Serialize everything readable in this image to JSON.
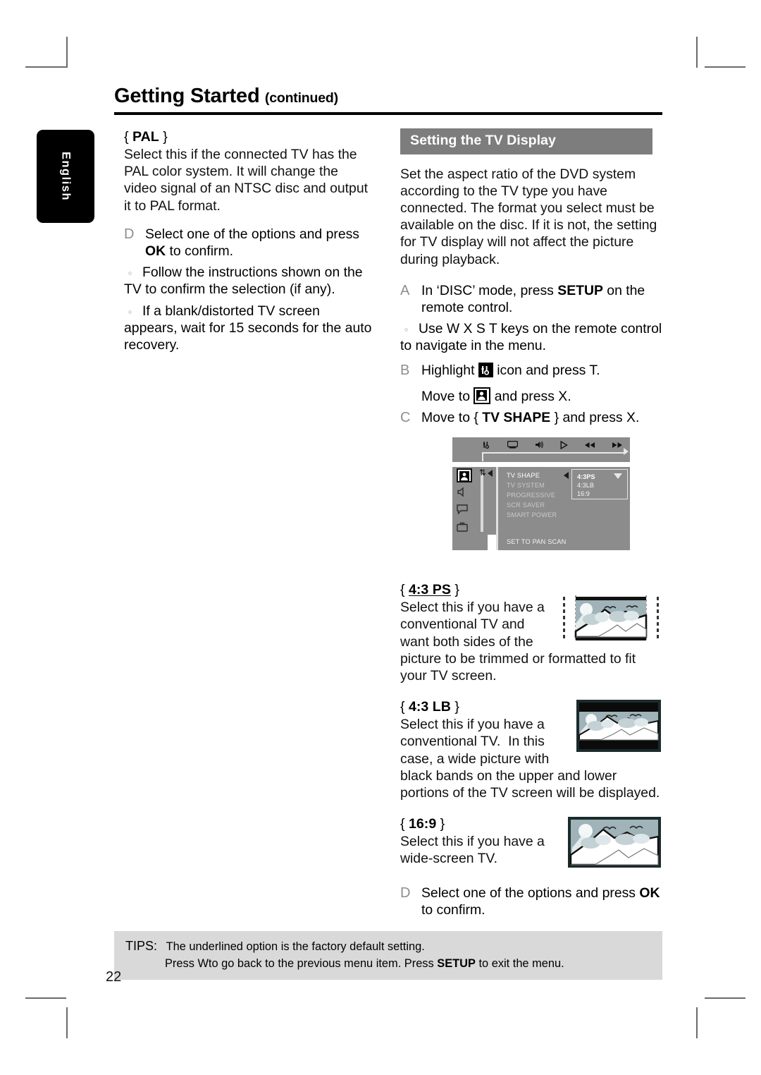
{
  "page": {
    "number": "22",
    "language_tab": "English",
    "header": {
      "title_main": "Getting Started",
      "title_cont": "(continued)"
    }
  },
  "left_column": {
    "pal_option": {
      "title_open": "{",
      "title_label": "PAL",
      "title_close": "}",
      "body": "Select this if the connected TV has the PAL color system. It will change the video signal of an NTSC disc and output it to PAL format."
    },
    "step_d": {
      "letter": "D",
      "text_before": "Select one of the options and press ",
      "bold": "OK",
      "text_after": " to confirm."
    },
    "bullets": [
      "Follow the instructions shown on the TV to confirm the selection (if any).",
      "If a blank/distorted TV screen appears, wait for 15 seconds for the auto recovery."
    ]
  },
  "right_column": {
    "section_heading": "Setting the TV Display",
    "intro": "Set the aspect ratio of the DVD system according to the TV type you have connected. The format you select must be available on the disc.  If it is not, the setting for TV display will not affect the picture during playback.",
    "steps": [
      {
        "letter": "A",
        "text_before": "In ‘DISC’ mode, press ",
        "bold": "SETUP",
        "text_after": " on the remote control."
      },
      {
        "letter": "B",
        "text_before": "Highlight ",
        "icon": "setup-tools-icon",
        "text_after": " icon and press  T."
      },
      {
        "letter": "",
        "text_before": "Move to ",
        "icon": "video-setup-icon",
        "text_after": " and press  X."
      },
      {
        "letter": "C",
        "text_before": "Move to { ",
        "bold": "TV SHAPE",
        "text_after": " } and press  X."
      }
    ],
    "bullet_a": "Use  W X S T keys on the remote control to navigate in the menu.",
    "final_step": {
      "letter": "D",
      "text_before": "Select one of the options and press ",
      "bold": "OK",
      "text_after": " to confirm."
    }
  },
  "osd_menu": {
    "topbar_icons": [
      "setup-tools-icon",
      "tv-screen-icon",
      "speaker-person-icon",
      "play-icon",
      "rewind-icon",
      "forward-icon"
    ],
    "side_icons": [
      "video-setup-icon",
      "audio-setup-icon",
      "subtitle-setup-icon",
      "preference-setup-icon"
    ],
    "items": [
      "TV SHAPE",
      "TV SYSTEM",
      "PROGRESSIVE",
      "SCR SAVER",
      "SMART POWER"
    ],
    "footer_item": "SET TO PAN SCAN",
    "values": [
      "4:3PS",
      "4:3LB",
      "16:9"
    ],
    "selected_value": "4:3PS"
  },
  "aspect_options": [
    {
      "open": "{",
      "label": "4:3 PS",
      "close": "}",
      "underlined": true,
      "body": "Select this if you have a conventional TV and want both sides of the picture to be trimmed or formatted to fit your TV screen.",
      "picture": "pan-scan-filmstrip"
    },
    {
      "open": "{",
      "label": "4:3 LB",
      "close": "}",
      "underlined": false,
      "body": "Select this if you have a conventional TV.  In this case, a wide picture with black bands on the upper and lower portions of the TV screen will be displayed.",
      "picture": "letterbox-screen"
    },
    {
      "open": "{",
      "label": "16:9",
      "close": "}",
      "underlined": false,
      "body": "Select this if you have a wide-screen TV.",
      "picture": "widescreen-screen"
    }
  ],
  "tips": {
    "label": "TIPS:",
    "line1": "The underlined option is the factory default setting.",
    "line2_a": "Press  Wto go back to the previous menu item.  Press ",
    "line2_bold": "SETUP",
    "line2_b": " to exit the menu."
  },
  "colors": {
    "section_bar": "#7d7d7d",
    "tips_bg": "#d9d9d9",
    "osd_bg": "#8c8c8c",
    "sky": "#9fb3b8",
    "rule": "#000000"
  }
}
